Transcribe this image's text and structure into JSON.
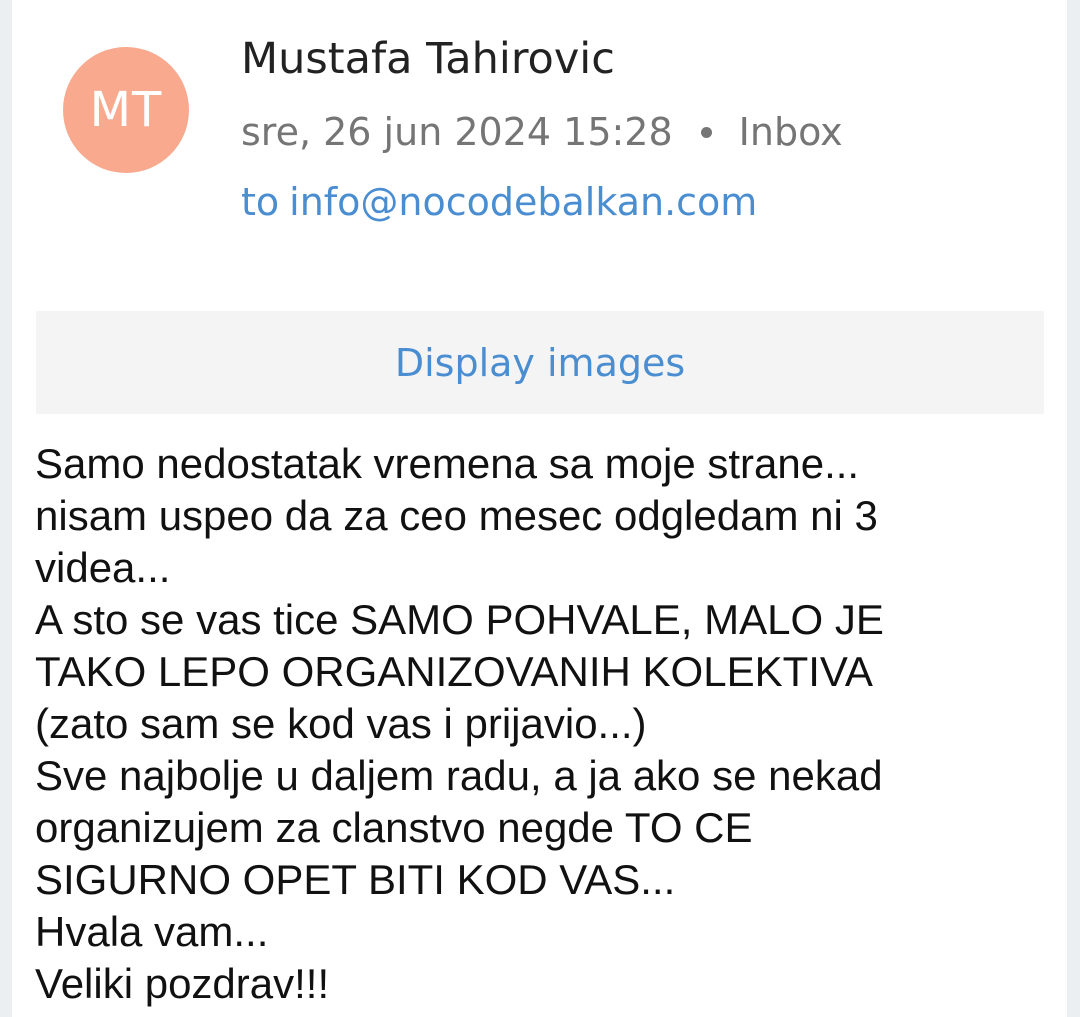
{
  "sender": {
    "initials": "MT",
    "avatar_color": "#f8a98e",
    "name": "Mustafa Tahirovic"
  },
  "meta": {
    "date": "sre, 26 jun 2024 15:28",
    "folder": "Inbox"
  },
  "recipient": {
    "prefix": "to",
    "address": "info@nocodebalkan.com"
  },
  "display_images_label": "Display images",
  "body_lines": [
    "Samo nedostatak vremena sa moje strane...",
    "nisam uspeo da za ceo mesec odgledam ni 3",
    "videa...",
    "A sto se vas tice SAMO POHVALE, MALO JE",
    "TAKO LEPO ORGANIZOVANIH KOLEKTIVA",
    "(zato sam se kod vas i prijavio...)",
    "Sve najbolje u daljem radu, a ja ako se nekad",
    "organizujem za clanstvo negde TO CE",
    "SIGURNO OPET BITI KOD VAS...",
    "Hvala vam...",
    "Veliki pozdrav!!!"
  ],
  "colors": {
    "link": "#4a8ed1",
    "secondary_text": "#757575",
    "banner_bg": "#f4f4f4"
  }
}
